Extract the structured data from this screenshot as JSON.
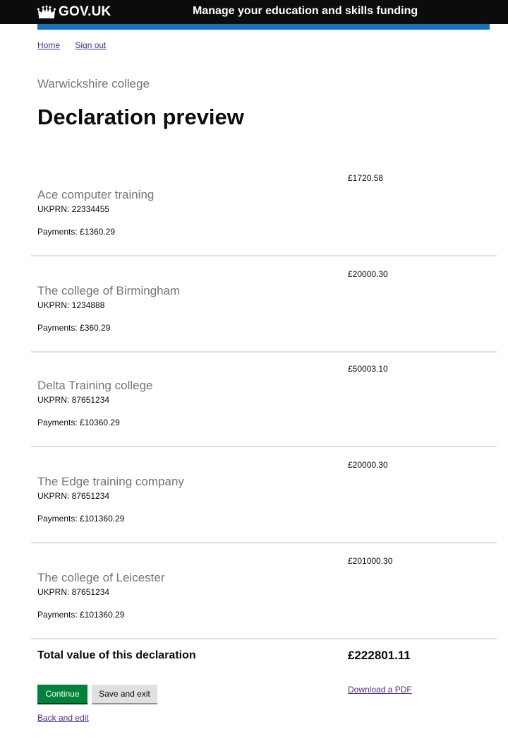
{
  "header": {
    "logo_text": "GOV.UK",
    "service_name": "Manage your education and skills funding"
  },
  "nav": {
    "home": "Home",
    "sign_out": "Sign out"
  },
  "page": {
    "caption": "Warwickshire college",
    "title": "Declaration preview"
  },
  "providers": [
    {
      "name": "Ace computer training",
      "ukprn": "UKPRN: 22334455",
      "payments": "Payments: £1360.29",
      "amount": "£1720.58"
    },
    {
      "name": "The college of Birmingham",
      "ukprn": "UKPRN: 1234888",
      "payments": "Payments: £360.29",
      "amount": "£20000.30"
    },
    {
      "name": "Delta Training college",
      "ukprn": "UKPRN: 87651234",
      "payments": "Payments: £10360.29",
      "amount": "£50003.10"
    },
    {
      "name": "The Edge training company",
      "ukprn": "UKPRN: 87651234",
      "payments": "Payments: £101360.29",
      "amount": "£20000.30"
    },
    {
      "name": "The college of Leicester",
      "ukprn": "UKPRN: 87651234",
      "payments": "Payments: £101360.29",
      "amount": "£201000.30"
    }
  ],
  "total": {
    "label": "Total value of this declaration",
    "value": "£222801.11"
  },
  "actions": {
    "continue": "Continue",
    "save_and_exit": "Save and exit",
    "download_pdf": "Download a PDF",
    "back_and_edit": "Back and edit"
  },
  "colors": {
    "header_bg": "#0b0c0c",
    "brand_blue": "#1d70b8",
    "continue_green": "#00823b",
    "link_purple": "#4c2c92",
    "secondary_text": "#6f777b"
  }
}
